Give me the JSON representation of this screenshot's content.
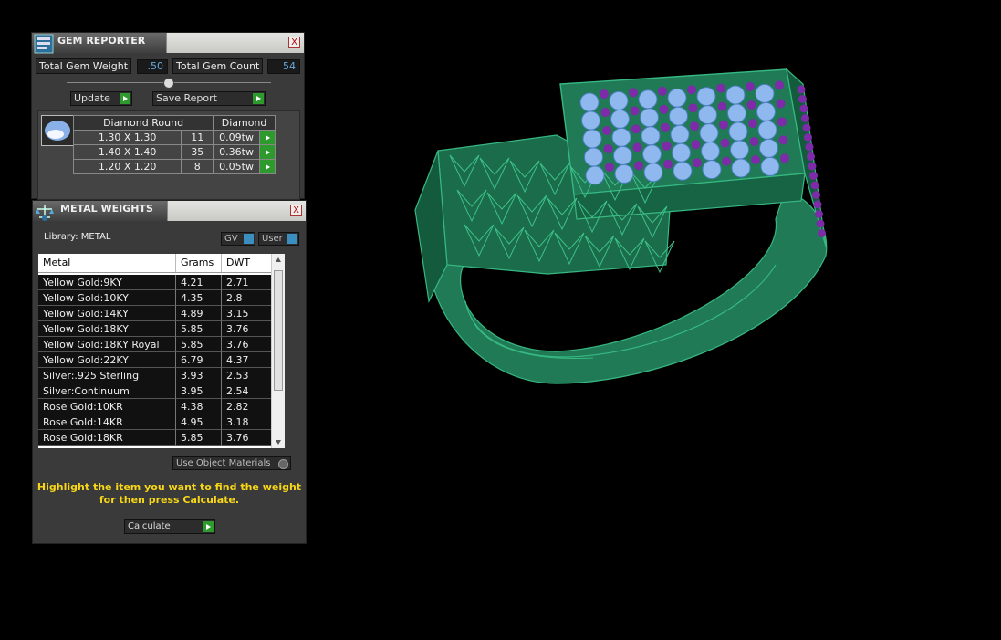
{
  "gem_reporter": {
    "title": "GEM REPORTER",
    "close_label": "X",
    "total_weight_label": "Total Gem Weight",
    "total_weight_value": ".50",
    "total_count_label": "Total Gem Count",
    "total_count_value": "54",
    "update_label": "Update",
    "save_report_label": "Save Report",
    "table": {
      "headers": [
        "Diamond Round",
        "Diamond"
      ],
      "rows": [
        {
          "size": "1.30 X 1.30",
          "count": "11",
          "weight": "0.09tw"
        },
        {
          "size": "1.40 X 1.40",
          "count": "35",
          "weight": "0.36tw"
        },
        {
          "size": "1.20 X 1.20",
          "count": "8",
          "weight": "0.05tw"
        }
      ]
    }
  },
  "metal_weights": {
    "title": "METAL WEIGHTS",
    "close_label": "X",
    "library_label": "Library: METAL",
    "gv_label": "GV",
    "user_label": "User",
    "columns": [
      "Metal",
      "Grams",
      "DWT"
    ],
    "rows": [
      {
        "metal": "Yellow Gold:9KY",
        "grams": "4.21",
        "dwt": "2.71"
      },
      {
        "metal": "Yellow Gold:10KY",
        "grams": "4.35",
        "dwt": "2.8"
      },
      {
        "metal": "Yellow Gold:14KY",
        "grams": "4.89",
        "dwt": "3.15"
      },
      {
        "metal": "Yellow Gold:18KY",
        "grams": "5.85",
        "dwt": "3.76"
      },
      {
        "metal": "Yellow Gold:18KY Royal",
        "grams": "5.85",
        "dwt": "3.76"
      },
      {
        "metal": "Yellow Gold:22KY",
        "grams": "6.79",
        "dwt": "4.37"
      },
      {
        "metal": "Silver:.925 Sterling",
        "grams": "3.93",
        "dwt": "2.53"
      },
      {
        "metal": "Silver:Continuum",
        "grams": "3.95",
        "dwt": "2.54"
      },
      {
        "metal": "Rose Gold:10KR",
        "grams": "4.38",
        "dwt": "2.82"
      },
      {
        "metal": "Rose Gold:14KR",
        "grams": "4.95",
        "dwt": "3.18"
      },
      {
        "metal": "Rose Gold:18KR",
        "grams": "5.85",
        "dwt": "3.76"
      }
    ],
    "use_object_materials_label": "Use Object Materials",
    "hint_line1": "Highlight the item you want to find the weight",
    "hint_line2": "for then press Calculate.",
    "calculate_label": "Calculate"
  },
  "viewport": {
    "object_icon": "ring-3d-model"
  },
  "colors": {
    "panel_bg": "#3a3a3a",
    "accent_green": "#2e9a2e",
    "hint_yellow": "#f7d716",
    "metal_green": "#1f7a55",
    "stone_blue": "#8fb8ee",
    "stone_purple": "#7d2ba8"
  }
}
